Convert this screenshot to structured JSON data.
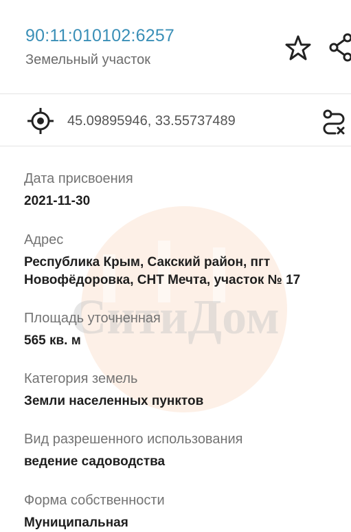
{
  "header": {
    "cadastral_number": "90:11:010102:6257",
    "property_type": "Земельный участок",
    "accent_color": "#3a8fb7"
  },
  "icons": {
    "favorite": "star-outline-icon",
    "share": "share-icon",
    "location": "crosshair-target-icon",
    "route": "route-icon"
  },
  "coordinates": {
    "text": "45.09895946, 33.55737489"
  },
  "details": [
    {
      "label": "Дата присвоения",
      "value": "2021-11-30"
    },
    {
      "label": "Адрес",
      "value_line1": "Республика Крым, Сакский район, пгт",
      "value_line2": "Новофёдоровка, СНТ Мечта, участок № 17"
    },
    {
      "label": "Площадь уточненная",
      "value": "565 кв. м"
    },
    {
      "label": "Категория земель",
      "value": "Земли населенных пунктов"
    },
    {
      "label": "Вид разрешенного использования",
      "value": "ведение садоводства"
    },
    {
      "label": "Форма собственности",
      "value": "Муниципальная"
    }
  ],
  "watermark": {
    "text": "СитиДом"
  }
}
